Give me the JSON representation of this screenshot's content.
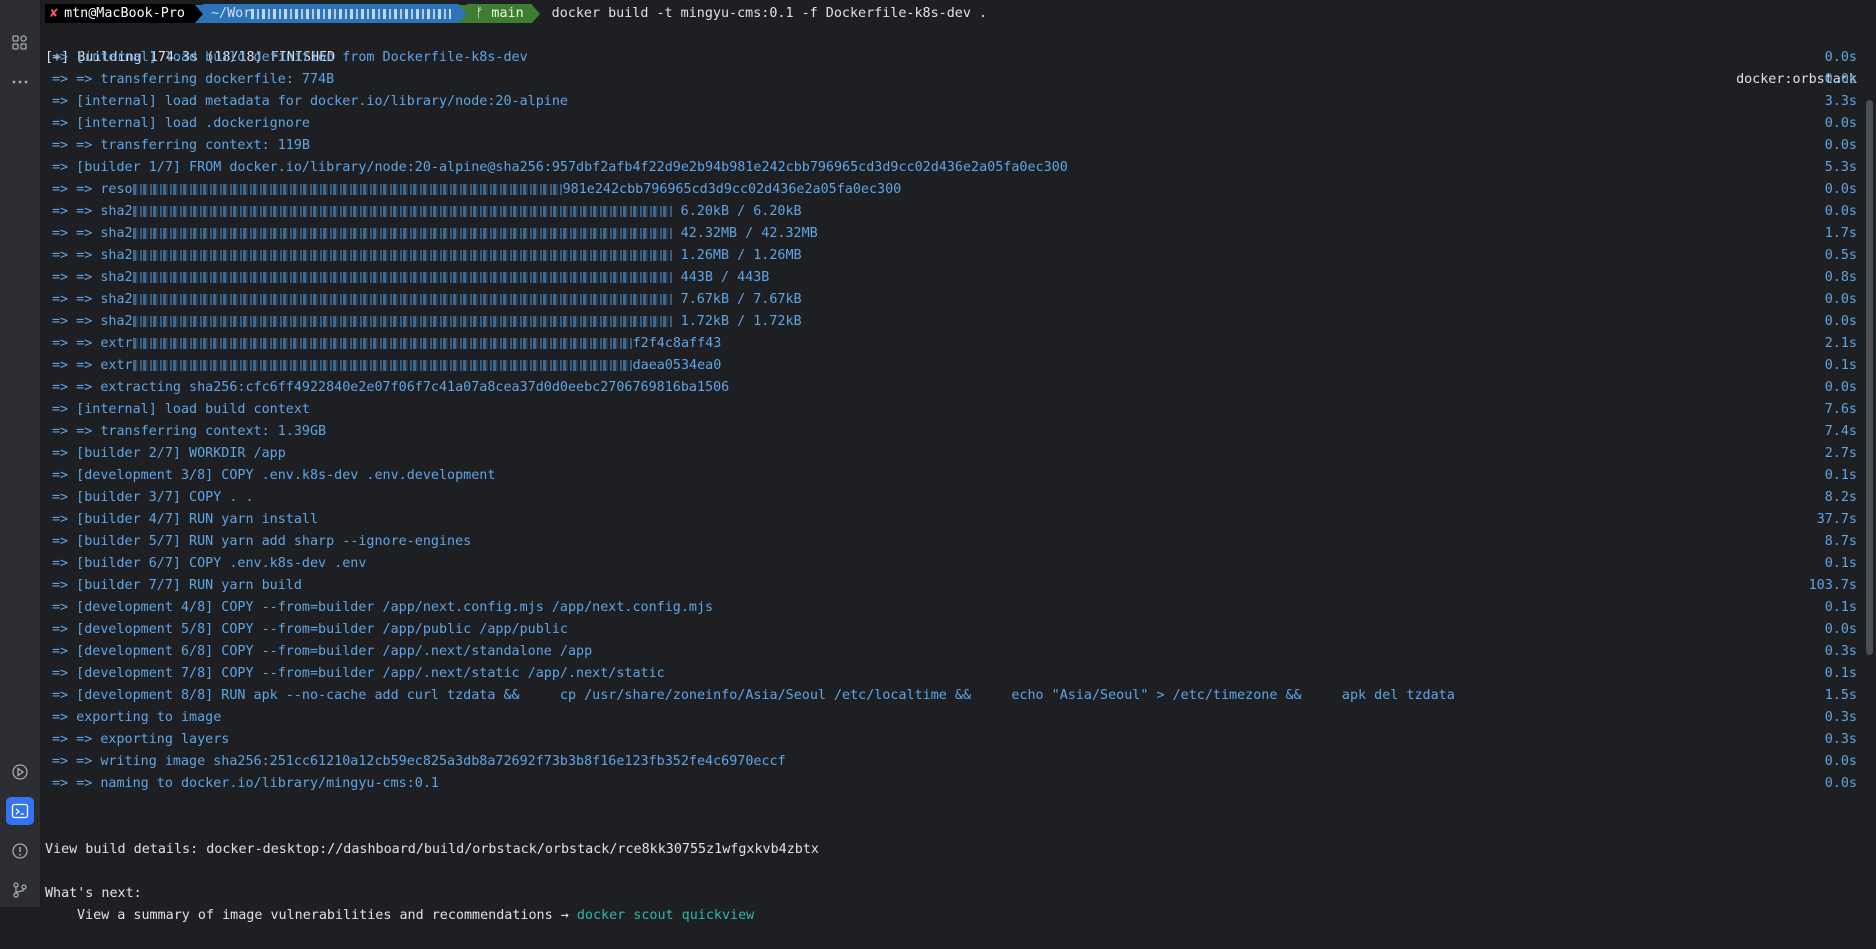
{
  "sidebar": {
    "top_icons": [
      "structure-icon",
      "more-icon"
    ],
    "bottom_icons": [
      "run-icon",
      "terminal-icon",
      "problems-icon",
      "git-icon"
    ]
  },
  "prompt": {
    "host": "mtn@MacBook-Pro",
    "path": "~/Wor",
    "branch": "main",
    "command": "docker build -t mingyu-cms:0.1 -f Dockerfile-k8s-dev ."
  },
  "build_header": {
    "text": "[+] Building 174.3s (18/18) FINISHED",
    "context": "docker:orbstack"
  },
  "steps": [
    {
      "text": "=> [internal] load build definition from Dockerfile-k8s-dev",
      "dur": "0.0s"
    },
    {
      "text": "=> => transferring dockerfile: 774B",
      "dur": "0.0s"
    },
    {
      "text": "=> [internal] load metadata for docker.io/library/node:20-alpine",
      "dur": "3.3s"
    },
    {
      "text": "=> [internal] load .dockerignore",
      "dur": "0.0s"
    },
    {
      "text": "=> => transferring context: 119B",
      "dur": "0.0s"
    },
    {
      "text": "=> [builder 1/7] FROM docker.io/library/node:20-alpine@sha256:957dbf2afb4f22d9e2b94b981e242cbb796965cd3d9cc02d436e2a05fa0ec300",
      "dur": "5.3s"
    },
    {
      "text": "=> => reso",
      "tail": "981e242cbb796965cd3d9cc02d436e2a05fa0ec300",
      "blur": 430,
      "dur": "0.0s"
    },
    {
      "text": "=> => sha2",
      "tail": " 6.20kB / 6.20kB",
      "blur": 540,
      "dur": "0.0s"
    },
    {
      "text": "=> => sha2",
      "tail": " 42.32MB / 42.32MB",
      "blur": 540,
      "dur": "1.7s"
    },
    {
      "text": "=> => sha2",
      "tail": " 1.26MB / 1.26MB",
      "blur": 540,
      "dur": "0.5s"
    },
    {
      "text": "=> => sha2",
      "tail": " 443B / 443B",
      "blur": 540,
      "dur": "0.8s"
    },
    {
      "text": "=> => sha2",
      "tail": " 7.67kB / 7.67kB",
      "blur": 540,
      "dur": "0.0s"
    },
    {
      "text": "=> => sha2",
      "tail": " 1.72kB / 1.72kB",
      "blur": 540,
      "dur": "0.0s"
    },
    {
      "text": "=> => extr",
      "tail": "f2f4c8aff43",
      "blur": 500,
      "dur": "2.1s"
    },
    {
      "text": "=> => extr",
      "tail": "daea0534ea0",
      "blur": 500,
      "dur": "0.1s"
    },
    {
      "text": "=> => extracting sha256:cfc6ff4922840e2e07f06f7c41a07a8cea37d0d0eebc2706769816ba1506",
      "dur": "0.0s"
    },
    {
      "text": "=> [internal] load build context",
      "dur": "7.6s"
    },
    {
      "text": "=> => transferring context: 1.39GB",
      "dur": "7.4s"
    },
    {
      "text": "=> [builder 2/7] WORKDIR /app",
      "dur": "2.7s"
    },
    {
      "text": "=> [development 3/8] COPY .env.k8s-dev .env.development",
      "dur": "0.1s"
    },
    {
      "text": "=> [builder 3/7] COPY . .",
      "dur": "8.2s"
    },
    {
      "text": "=> [builder 4/7] RUN yarn install",
      "dur": "37.7s"
    },
    {
      "text": "=> [builder 5/7] RUN yarn add sharp --ignore-engines",
      "dur": "8.7s"
    },
    {
      "text": "=> [builder 6/7] COPY .env.k8s-dev .env",
      "dur": "0.1s"
    },
    {
      "text": "=> [builder 7/7] RUN yarn build",
      "dur": "103.7s"
    },
    {
      "text": "=> [development 4/8] COPY --from=builder /app/next.config.mjs /app/next.config.mjs",
      "dur": "0.1s"
    },
    {
      "text": "=> [development 5/8] COPY --from=builder /app/public /app/public",
      "dur": "0.0s"
    },
    {
      "text": "=> [development 6/8] COPY --from=builder /app/.next/standalone /app",
      "dur": "0.3s"
    },
    {
      "text": "=> [development 7/8] COPY --from=builder /app/.next/static /app/.next/static",
      "dur": "0.1s"
    },
    {
      "text": "=> [development 8/8] RUN apk --no-cache add curl tzdata &&     cp /usr/share/zoneinfo/Asia/Seoul /etc/localtime &&     echo \"Asia/Seoul\" > /etc/timezone &&     apk del tzdata",
      "dur": "1.5s"
    },
    {
      "text": "=> exporting to image",
      "dur": "0.3s"
    },
    {
      "text": "=> => exporting layers",
      "dur": "0.3s"
    },
    {
      "text": "=> => writing image sha256:251cc61210a12cb59ec825a3db8a72692f73b3b8f16e123fb352fe4c6970eccf",
      "dur": "0.0s"
    },
    {
      "text": "=> => naming to docker.io/library/mingyu-cms:0.1",
      "dur": "0.0s"
    }
  ],
  "details": "View build details: docker-desktop://dashboard/build/orbstack/orbstack/rce8kk30755z1wfgxkvb4zbtx",
  "next_heading": "What's next:",
  "next_line": {
    "text": "View a summary of image vulnerabilities and recommendations → ",
    "cmd": "docker scout quickview"
  },
  "colors": {
    "accent": "#3574f0",
    "step": "#5ea5e6",
    "link": "#2fb8a8",
    "background": "#1e1f22"
  }
}
